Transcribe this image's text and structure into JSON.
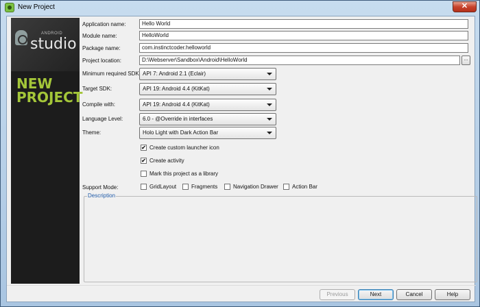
{
  "window": {
    "title": "New Project",
    "close_glyph": "✕"
  },
  "sidebar": {
    "logo_small": "ANDROID",
    "logo_big": "studio",
    "heading_line1": "NEW",
    "heading_line2": "PROJECT"
  },
  "form": {
    "app_name": {
      "label": "Application name:",
      "value": "Hello World"
    },
    "module_name": {
      "label": "Module name:",
      "value": "HelloWorld"
    },
    "package_name": {
      "label": "Package name:",
      "value": "com.instinctcoder.helloworld"
    },
    "project_location": {
      "label": "Project location:",
      "value": "D:\\Webserver\\Sandbox\\Android\\HelloWorld",
      "browse_label": "..."
    },
    "min_sdk": {
      "label": "Minimum required SDK:",
      "value": "API 7: Android 2.1 (Eclair)"
    },
    "target_sdk": {
      "label": "Target SDK:",
      "value": "API 19: Android 4.4 (KitKat)"
    },
    "compile_with": {
      "label": "Compile with:",
      "value": "API 19: Android 4.4 (KitKat)"
    },
    "language_level": {
      "label": "Language Level:",
      "value": "6.0 - @Override in interfaces"
    },
    "theme": {
      "label": "Theme:",
      "value": "Holo Light with Dark Action Bar"
    }
  },
  "checkboxes": [
    {
      "label": "Create custom launcher icon",
      "checked": true,
      "glyph": "✔"
    },
    {
      "label": "Create activity",
      "checked": true,
      "glyph": "✔"
    },
    {
      "label": "Mark this project as a library",
      "checked": false,
      "glyph": ""
    }
  ],
  "support_mode": {
    "label": "Support Mode:",
    "options": [
      {
        "label": "GridLayout",
        "checked": false
      },
      {
        "label": "Fragments",
        "checked": false
      },
      {
        "label": "Navigation Drawer",
        "checked": false
      },
      {
        "label": "Action Bar",
        "checked": false
      }
    ]
  },
  "description": {
    "legend": "Description"
  },
  "buttons": {
    "previous": "Previous",
    "next": "Next",
    "cancel": "Cancel",
    "help": "Help"
  },
  "colors": {
    "accent": "#a4c639",
    "sidebar_bg": "#1c1c1c",
    "legend": "#1e5aa8"
  }
}
